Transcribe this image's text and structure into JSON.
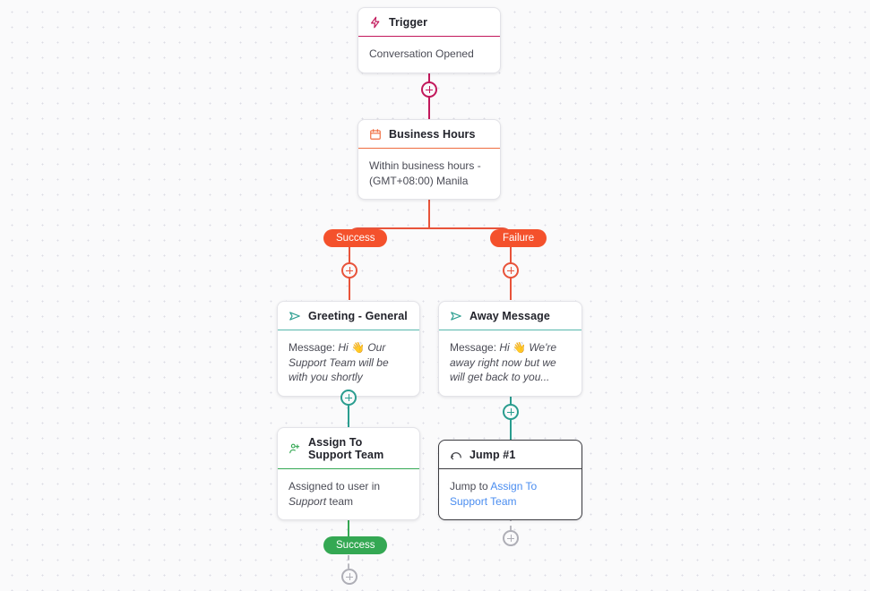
{
  "canvas": {
    "background_color": "#fafafb",
    "dot_color": "#dcdce4"
  },
  "colors": {
    "trigger": "#c2185b",
    "business_hours": "#ef6c3e",
    "branch_line": "#e8533a",
    "badge_orange": "#f4512c",
    "badge_green": "#34a853",
    "message_teal": "#2a9d8f",
    "assign_green": "#34a853",
    "jump_border": "#3b3b40",
    "link_blue": "#4a8df0",
    "inactive_gray": "#aeaeb6"
  },
  "nodes": {
    "trigger": {
      "title": "Trigger",
      "icon": "lightning-bolt-icon",
      "body": "Conversation Opened"
    },
    "business_hours": {
      "title": "Business Hours",
      "icon": "calendar-icon",
      "body_line1": "Within business hours -",
      "body_line2": "(GMT+08:00) Manila"
    },
    "greeting": {
      "title": "Greeting - General",
      "icon": "send-message-icon",
      "body_prefix": "Message: ",
      "body_emoji": "👋",
      "body_text_before": "Hi ",
      "body_text_after": " Our Support Team will be with you shortly"
    },
    "away_message": {
      "title": "Away Message",
      "icon": "send-message-icon",
      "body_prefix": "Message: ",
      "body_emoji": "👋",
      "body_text_before": "Hi ",
      "body_text_after": " We're away right now but we will get back to you..."
    },
    "assign": {
      "title": "Assign To Support Team",
      "icon": "person-add-icon",
      "body_before": "Assigned to user in ",
      "body_italic": "Support",
      "body_after": " team"
    },
    "jump": {
      "title": "Jump #1",
      "icon": "jump-arc-icon",
      "body_before": "Jump to ",
      "body_link": "Assign To Support Team"
    }
  },
  "badges": {
    "success_branch": "Success",
    "failure_branch": "Failure",
    "success_assign": "Success"
  },
  "add_buttons": {
    "after_trigger": "+",
    "after_success_branch": "+",
    "after_failure_branch": "+",
    "after_greeting": "+",
    "after_away_message": "+",
    "after_jump": "+",
    "after_assign_success": "+"
  }
}
